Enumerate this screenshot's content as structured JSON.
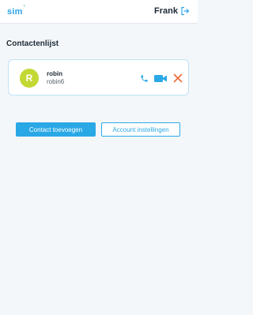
{
  "header": {
    "logo_text": "sim",
    "logo_mark": "°",
    "username": "Frank",
    "logout_icon": "logout-icon"
  },
  "main": {
    "title": "Contactenlijst",
    "contacts": [
      {
        "initial": "R",
        "name": "robin",
        "id": "robin6",
        "avatar_color": "#c3d832",
        "actions": [
          "phone-icon",
          "video-camera-icon",
          "close-icon"
        ]
      }
    ]
  },
  "buttons": {
    "add_contact": "Contact toevoegen",
    "account_settings": "Account instellingen"
  },
  "colors": {
    "accent": "#2aa8e6",
    "remove": "#f06a3a",
    "background": "#f4f7fa"
  }
}
